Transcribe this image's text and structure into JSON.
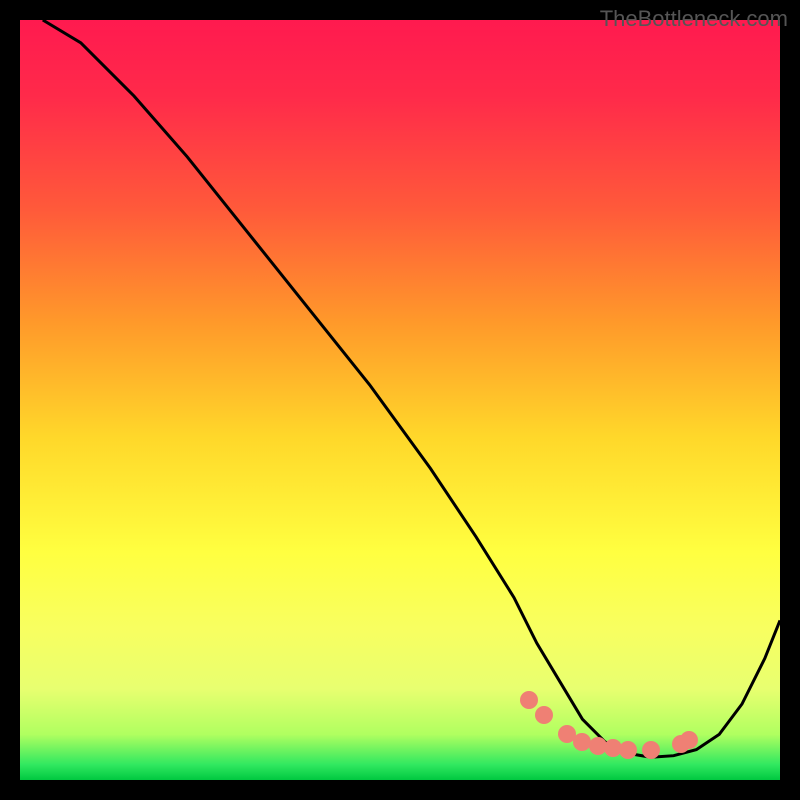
{
  "watermark": "TheBottleneck.com",
  "chart_data": {
    "type": "line",
    "title": "",
    "xlabel": "",
    "ylabel": "",
    "xlim": [
      0,
      100
    ],
    "ylim": [
      0,
      100
    ],
    "series": [
      {
        "name": "curve",
        "x": [
          3,
          8,
          15,
          22,
          30,
          38,
          46,
          54,
          60,
          65,
          68,
          71,
          74,
          77,
          80,
          83,
          86,
          89,
          92,
          95,
          98,
          100
        ],
        "y": [
          100,
          97,
          90,
          82,
          72,
          62,
          52,
          41,
          32,
          24,
          18,
          13,
          8,
          5,
          3.5,
          3,
          3.2,
          4,
          6,
          10,
          16,
          21
        ]
      }
    ],
    "highlight_points": {
      "name": "dots",
      "x": [
        67,
        69,
        72,
        74,
        76,
        78,
        80,
        83,
        87,
        88
      ],
      "y": [
        10.5,
        8.5,
        6,
        5,
        4.5,
        4.2,
        4.0,
        4.0,
        4.8,
        5.3
      ]
    },
    "gradient_stops": [
      {
        "pos": 0.0,
        "color": "#ff1a4f"
      },
      {
        "pos": 0.25,
        "color": "#ff5a3a"
      },
      {
        "pos": 0.55,
        "color": "#ffd82a"
      },
      {
        "pos": 0.8,
        "color": "#f8ff60"
      },
      {
        "pos": 0.98,
        "color": "#30e860"
      },
      {
        "pos": 1.0,
        "color": "#00c840"
      }
    ]
  }
}
